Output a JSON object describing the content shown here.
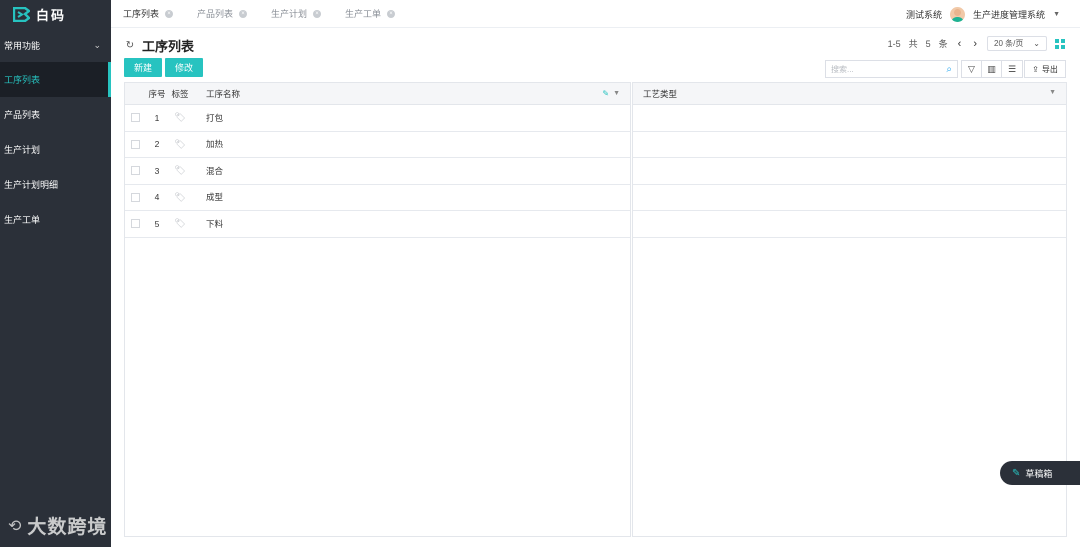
{
  "brand": {
    "name": "白码"
  },
  "sidebar": {
    "group_label": "常用功能",
    "items": [
      {
        "label": "工序列表",
        "active": true
      },
      {
        "label": "产品列表",
        "active": false
      },
      {
        "label": "生产计划",
        "active": false
      },
      {
        "label": "生产计划明细",
        "active": false
      },
      {
        "label": "生产工单",
        "active": false
      }
    ]
  },
  "tabs": [
    {
      "label": "工序列表",
      "active": true
    },
    {
      "label": "产品列表",
      "active": false
    },
    {
      "label": "生产计划",
      "active": false
    },
    {
      "label": "生产工单",
      "active": false
    }
  ],
  "header": {
    "system_label": "测试系统",
    "user_name": "生产进度管理系统"
  },
  "page": {
    "title": "工序列表",
    "pager_range": "1-5",
    "pager_total_prefix": "共",
    "pager_total": "5",
    "pager_total_suffix": "条",
    "page_size": "20 条/页"
  },
  "toolbar": {
    "new_label": "新建",
    "edit_label": "修改",
    "search_placeholder": "搜索...",
    "export_label": "导出"
  },
  "table": {
    "columns": {
      "index": "序号",
      "tag": "标签",
      "name": "工序名称",
      "type": "工艺类型"
    },
    "rows": [
      {
        "index": "1",
        "name": "打包",
        "type": ""
      },
      {
        "index": "2",
        "name": "加热",
        "type": ""
      },
      {
        "index": "3",
        "name": "混合",
        "type": ""
      },
      {
        "index": "4",
        "name": "成型",
        "type": ""
      },
      {
        "index": "5",
        "name": "下料",
        "type": ""
      }
    ]
  },
  "drafts": {
    "label": "草稿箱"
  },
  "watermark": {
    "text": "大数跨境"
  },
  "colors": {
    "accent": "#27c3c0",
    "sidebar_bg": "#2b3039"
  }
}
